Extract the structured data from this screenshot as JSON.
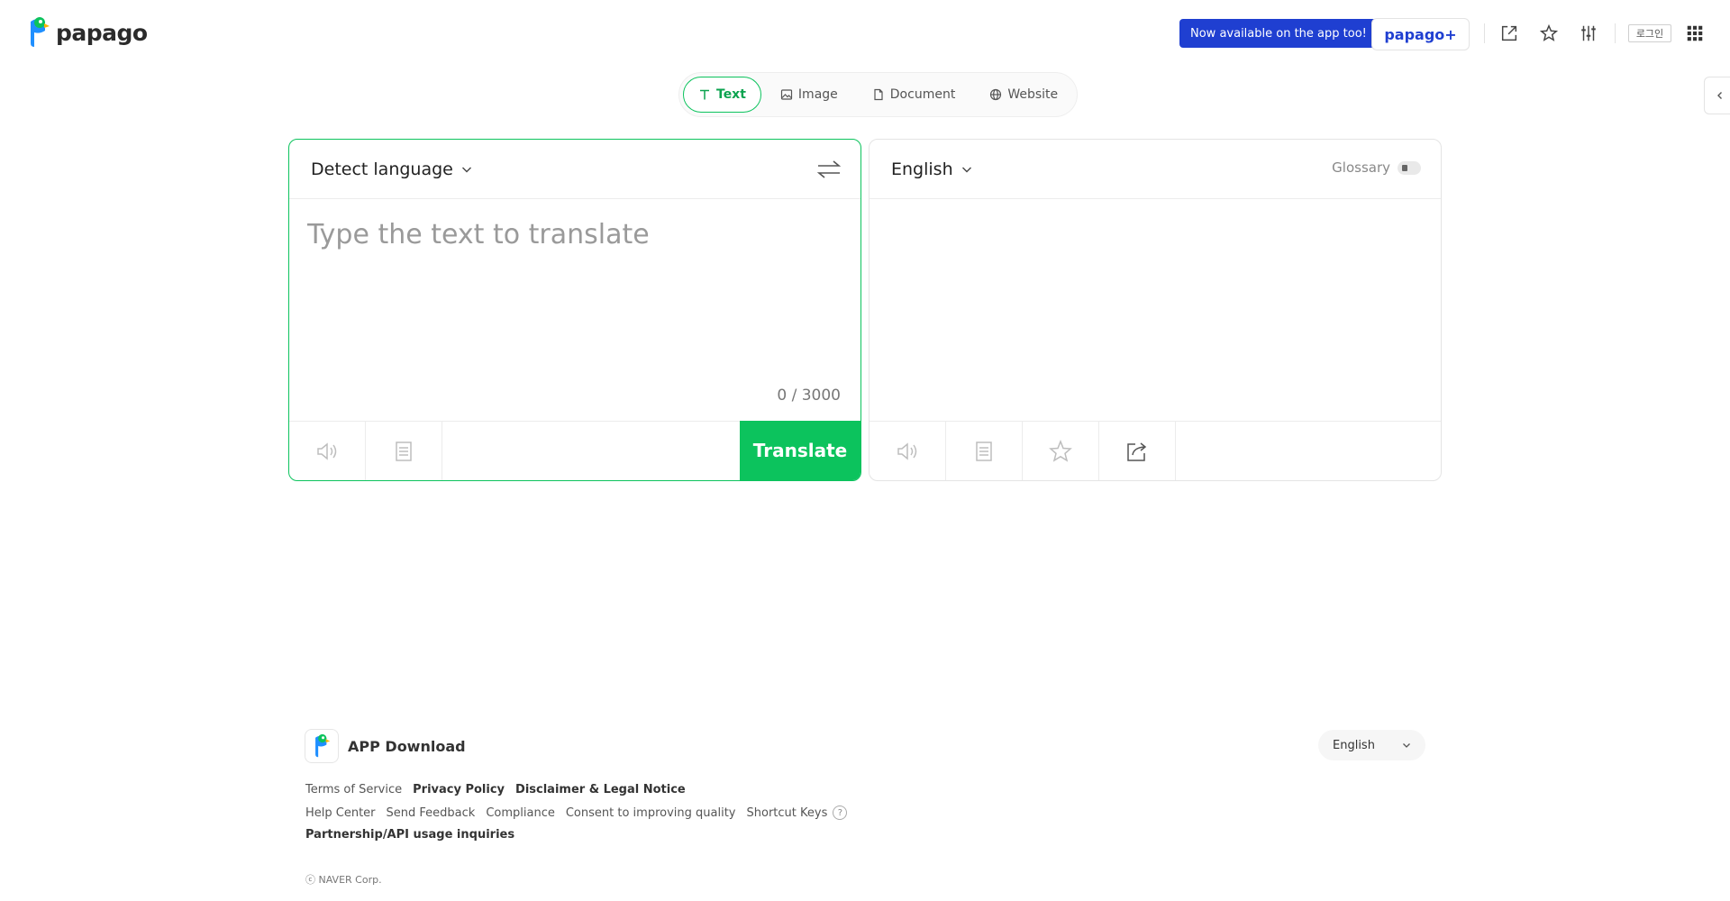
{
  "header": {
    "logo_text": "papago",
    "promo_text": "Now available on the app too!",
    "papago_plus_label": "papago+",
    "login_label": "로그인",
    "icons": [
      "open-external-icon",
      "star-icon",
      "settings-sliders-icon",
      "apps-grid-icon"
    ]
  },
  "mode_tabs": [
    {
      "label": "Text",
      "icon": "text-icon",
      "active": true
    },
    {
      "label": "Image",
      "icon": "image-icon",
      "active": false
    },
    {
      "label": "Document",
      "icon": "document-icon",
      "active": false
    },
    {
      "label": "Website",
      "icon": "globe-icon",
      "active": false
    }
  ],
  "source": {
    "language": "Detect language",
    "placeholder": "Type the text to translate",
    "value": "",
    "char_count": "0 / 3000",
    "translate_label": "Translate"
  },
  "target": {
    "language": "English",
    "glossary_label": "Glossary",
    "glossary_enabled": false
  },
  "footer": {
    "app_download_label": "APP Download",
    "language_selector": "English",
    "links_row1": [
      {
        "label": "Terms of Service",
        "strong": false
      },
      {
        "label": "Privacy Policy",
        "strong": true
      },
      {
        "label": "Disclaimer & Legal Notice",
        "strong": true
      }
    ],
    "links_row2": [
      {
        "label": "Help Center",
        "strong": false
      },
      {
        "label": "Send Feedback",
        "strong": false
      },
      {
        "label": "Compliance",
        "strong": false
      },
      {
        "label": "Consent to improving quality",
        "strong": false
      },
      {
        "label": "Shortcut Keys",
        "strong": false
      }
    ],
    "help_glyph": "?",
    "links_row3": [
      {
        "label": "Partnership/API usage inquiries",
        "strong": true
      }
    ],
    "copyright": "ⓒ NAVER Corp."
  },
  "colors": {
    "accent_green": "#0cc35d",
    "promo_blue": "#1f3fd1"
  }
}
